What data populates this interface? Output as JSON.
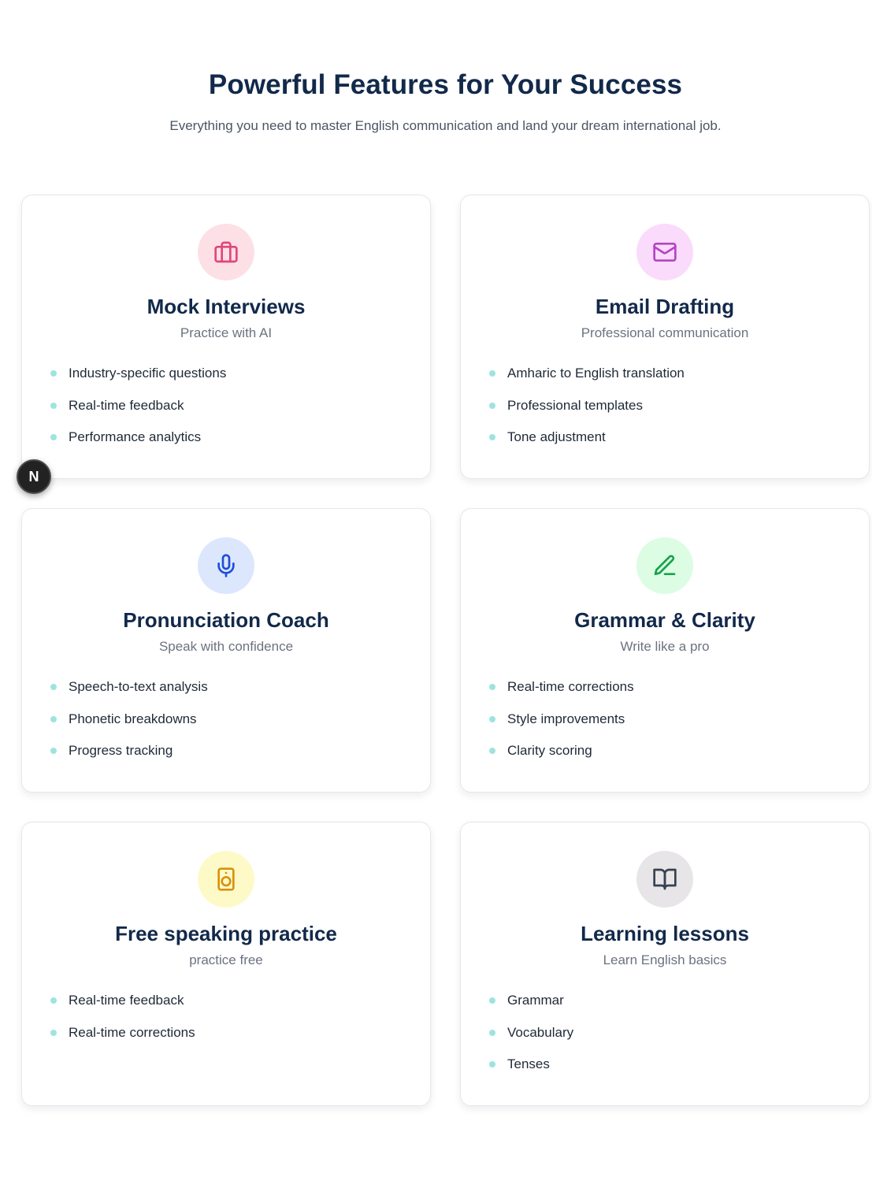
{
  "section": {
    "title": "Powerful Features for Your Success",
    "subtitle": "Everything you need to master English communication and land your dream international job."
  },
  "cards": [
    {
      "title": "Mock Interviews",
      "subtitle": "Practice with AI",
      "icon": "briefcase-icon",
      "icon_color": "#e0467c",
      "icon_bg": "#fde0e6",
      "features": [
        "Industry-specific questions",
        "Real-time feedback",
        "Performance analytics"
      ]
    },
    {
      "title": "Email Drafting",
      "subtitle": "Professional communication",
      "icon": "mail-icon",
      "icon_color": "#b545c4",
      "icon_bg": "#fadbfb",
      "features": [
        "Amharic to English translation",
        "Professional templates",
        "Tone adjustment"
      ]
    },
    {
      "title": "Pronunciation Coach",
      "subtitle": "Speak with confidence",
      "icon": "microphone-icon",
      "icon_color": "#1d4ed8",
      "icon_bg": "#dce7fe",
      "features": [
        "Speech-to-text analysis",
        "Phonetic breakdowns",
        "Progress tracking"
      ]
    },
    {
      "title": "Grammar & Clarity",
      "subtitle": "Write like a pro",
      "icon": "pencil-icon",
      "icon_color": "#16a34a",
      "icon_bg": "#dcfce4",
      "features": [
        "Real-time corrections",
        "Style improvements",
        "Clarity scoring"
      ]
    },
    {
      "title": "Free speaking practice",
      "subtitle": "practice free",
      "icon": "speaker-icon",
      "icon_color": "#d9920f",
      "icon_bg": "#fefac8",
      "features": [
        "Real-time feedback",
        "Real-time corrections"
      ]
    },
    {
      "title": "Learning lessons",
      "subtitle": "Learn English basics",
      "icon": "book-open-icon",
      "icon_color": "#374151",
      "icon_bg": "#e7e5e7",
      "features": [
        "Grammar",
        "Vocabulary",
        "Tenses"
      ]
    }
  ],
  "dev_badge": {
    "letter": "N"
  }
}
